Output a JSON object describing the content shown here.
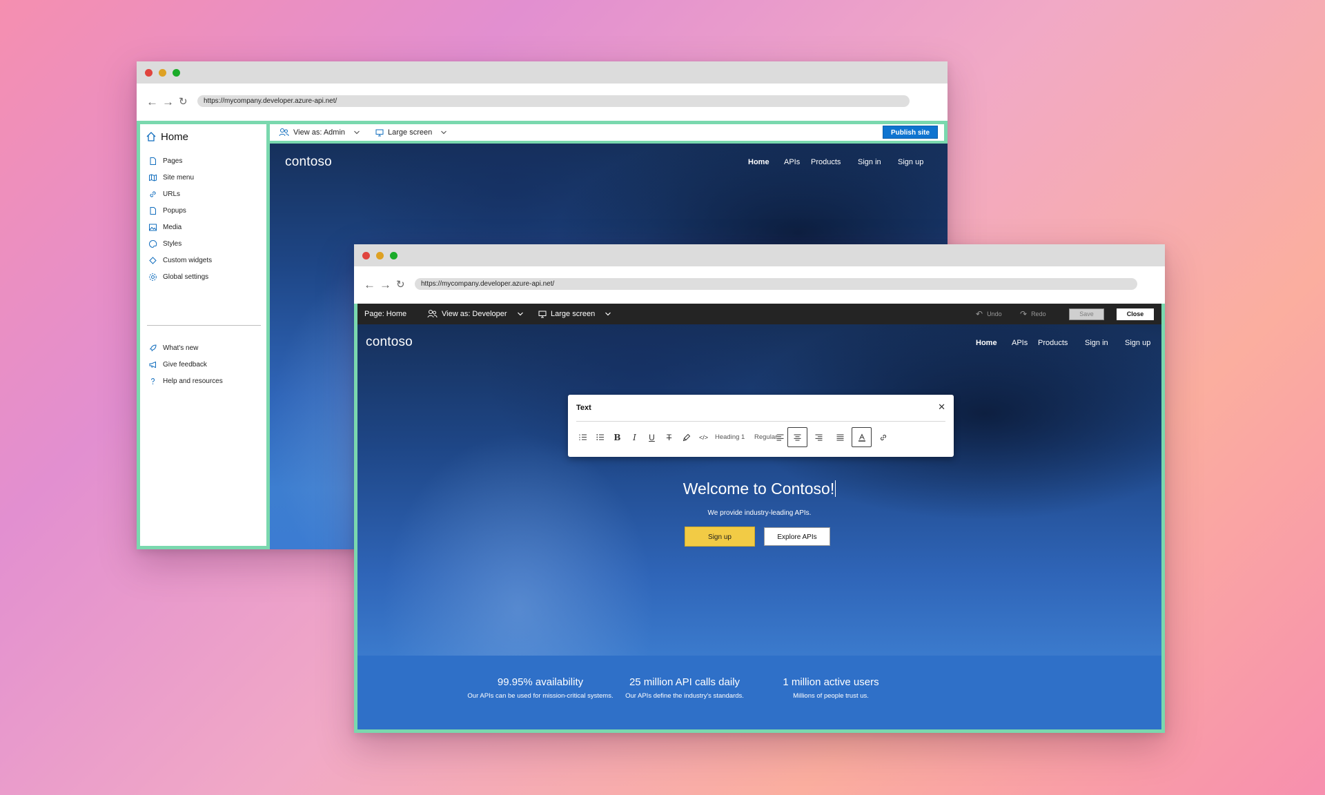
{
  "background": {
    "gradient_colors": [
      "#f58fb0",
      "#e28fd0",
      "#fbae9f"
    ]
  },
  "accent": {
    "frame": "#7ad8ae",
    "publish": "#0f74d0",
    "signup": "#f2cb45"
  },
  "window_back": {
    "url": "https://mycompany.developer.azure-api.net/",
    "sidebar": {
      "home": "Home",
      "items": [
        {
          "label": "Pages",
          "icon": "page-icon"
        },
        {
          "label": "Site menu",
          "icon": "map-icon"
        },
        {
          "label": "URLs",
          "icon": "link-icon"
        },
        {
          "label": "Popups",
          "icon": "popup-icon"
        },
        {
          "label": "Media",
          "icon": "image-icon"
        },
        {
          "label": "Styles",
          "icon": "palette-icon"
        },
        {
          "label": "Custom widgets",
          "icon": "widget-icon"
        },
        {
          "label": "Global settings",
          "icon": "gear-icon"
        }
      ],
      "footer_items": [
        {
          "label": "What's new",
          "icon": "rocket-icon"
        },
        {
          "label": "Give feedback",
          "icon": "megaphone-icon"
        },
        {
          "label": "Help and resources",
          "icon": "question-icon"
        }
      ]
    },
    "toolbar": {
      "view_as": "View as: Admin",
      "screen": "Large screen",
      "publish": "Publish site"
    },
    "site": {
      "logo": "contoso",
      "nav": [
        "Home",
        "APIs",
        "Products",
        "Sign in",
        "Sign up"
      ]
    }
  },
  "window_front": {
    "url": "https://mycompany.developer.azure-api.net/",
    "toolbar": {
      "page": "Page: Home",
      "view_as": "View as: Developer",
      "screen": "Large screen",
      "undo": "Undo",
      "redo": "Redo",
      "save": "Save",
      "close": "Close"
    },
    "site": {
      "logo": "contoso",
      "nav": [
        "Home",
        "APIs",
        "Products",
        "Sign in",
        "Sign up"
      ]
    },
    "text_panel": {
      "title": "Text",
      "heading_select": "Heading 1",
      "weight_select": "Regular"
    },
    "hero": {
      "title": "Welcome to Contoso!",
      "subtitle": "We provide industry-leading APIs.",
      "primary_button": "Sign up",
      "secondary_button": "Explore APIs"
    },
    "stats": [
      {
        "headline": "99.95% availability",
        "desc": "Our APIs can be used for mission-critical systems."
      },
      {
        "headline": "25 million API calls daily",
        "desc": "Our APIs define the industry's standards."
      },
      {
        "headline": "1 million active users",
        "desc": "Millions of people trust us."
      }
    ]
  }
}
